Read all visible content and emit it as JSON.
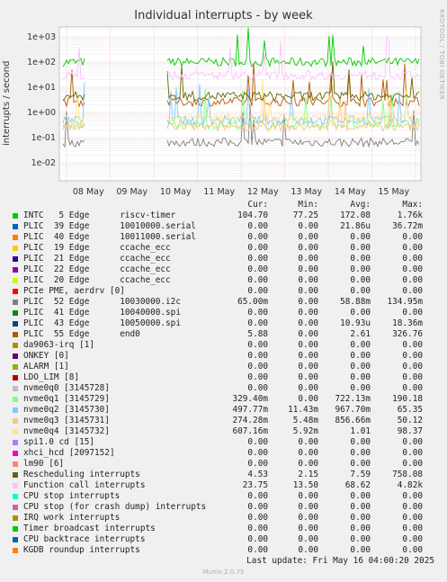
{
  "title": "Individual interrupts - by week",
  "side_label": "RRDTOOL / TOBI OETIKER",
  "footer": {
    "last_update": "Last update: Fri May 16 04:00:20 2025",
    "munin": "Munin 2.0.75"
  },
  "legend_headers": {
    "cur": "Cur:",
    "min": "Min:",
    "avg": "Avg:",
    "max": "Max:"
  },
  "chart_data": {
    "type": "line",
    "title": "Individual interrupts - by week",
    "ylabel": "interrupts / second",
    "yscale": "log",
    "ylim": [
      0.004,
      2000
    ],
    "y_ticks": [
      "1e+03",
      "1e+02",
      "1e+01",
      "1e+00",
      "1e-01",
      "1e-02"
    ],
    "x_ticks": [
      "08 May",
      "09 May",
      "10 May",
      "11 May",
      "12 May",
      "13 May",
      "14 May",
      "15 May"
    ],
    "no_data_period": "08 May 12:00 – 10 May 00:00",
    "series": [
      {
        "name": "INTC   5 Edge      riscv-timer",
        "color": "#00cc00",
        "cur": "104.70",
        "min": "77.25",
        "avg": "172.08",
        "max": "1.76k",
        "level": 100
      },
      {
        "name": "PLIC  39 Edge      10010000.serial",
        "color": "#0066b3",
        "cur": "0.00",
        "min": "0.00",
        "avg": "21.86u",
        "max": "36.72m"
      },
      {
        "name": "PLIC  40 Edge      10011000.serial",
        "color": "#ff8000",
        "cur": "0.00",
        "min": "0.00",
        "avg": "0.00",
        "max": "0.00"
      },
      {
        "name": "PLIC  19 Edge      ccache_ecc",
        "color": "#ffcc00",
        "cur": "0.00",
        "min": "0.00",
        "avg": "0.00",
        "max": "0.00"
      },
      {
        "name": "PLIC  21 Edge      ccache_ecc",
        "color": "#330099",
        "cur": "0.00",
        "min": "0.00",
        "avg": "0.00",
        "max": "0.00"
      },
      {
        "name": "PLIC  22 Edge      ccache_ecc",
        "color": "#990099",
        "cur": "0.00",
        "min": "0.00",
        "avg": "0.00",
        "max": "0.00"
      },
      {
        "name": "PLIC  20 Edge      ccache_ecc",
        "color": "#ccff00",
        "cur": "0.00",
        "min": "0.00",
        "avg": "0.00",
        "max": "0.00"
      },
      {
        "name": "PCIe PME, aerdrv [0]",
        "color": "#ff0000",
        "cur": "0.00",
        "min": "0.00",
        "avg": "0.00",
        "max": "0.00"
      },
      {
        "name": "PLIC  52 Edge      10030000.i2c",
        "color": "#808080",
        "cur": "65.00m",
        "min": "0.00",
        "avg": "58.88m",
        "max": "134.95m",
        "level": 0.065
      },
      {
        "name": "PLIC  41 Edge      10040000.spi",
        "color": "#008f00",
        "cur": "0.00",
        "min": "0.00",
        "avg": "0.00",
        "max": "0.00"
      },
      {
        "name": "PLIC  43 Edge      10050000.spi",
        "color": "#00487d",
        "cur": "0.00",
        "min": "0.00",
        "avg": "10.93u",
        "max": "18.36m"
      },
      {
        "name": "PLIC  55 Edge      end0",
        "color": "#b35a00",
        "cur": "5.88",
        "min": "0.00",
        "avg": "2.61",
        "max": "326.76",
        "level": 2.61
      },
      {
        "name": "da9063-irq [1]",
        "color": "#b38f00",
        "cur": "0.00",
        "min": "0.00",
        "avg": "0.00",
        "max": "0.00"
      },
      {
        "name": "ONKEY [0]",
        "color": "#6b006b",
        "cur": "0.00",
        "min": "0.00",
        "avg": "0.00",
        "max": "0.00"
      },
      {
        "name": "ALARM [1]",
        "color": "#8fb300",
        "cur": "0.00",
        "min": "0.00",
        "avg": "0.00",
        "max": "0.00"
      },
      {
        "name": "LDO_LIM [8]",
        "color": "#b30000",
        "cur": "0.00",
        "min": "0.00",
        "avg": "0.00",
        "max": "0.00"
      },
      {
        "name": "nvme0q0 [3145728]",
        "color": "#bebebe",
        "cur": "0.00",
        "min": "0.00",
        "avg": "0.00",
        "max": "0.00"
      },
      {
        "name": "nvme0q1 [3145729]",
        "color": "#80ff80",
        "cur": "329.40m",
        "min": "0.00",
        "avg": "722.13m",
        "max": "190.18",
        "level": 0.33
      },
      {
        "name": "nvme0q2 [3145730]",
        "color": "#80c9ff",
        "cur": "497.77m",
        "min": "11.43m",
        "avg": "967.70m",
        "max": "65.35",
        "level": 0.5
      },
      {
        "name": "nvme0q3 [3145731]",
        "color": "#ffc080",
        "cur": "274.28m",
        "min": "5.48m",
        "avg": "856.66m",
        "max": "50.12",
        "level": 0.27
      },
      {
        "name": "nvme0q4 [3145732]",
        "color": "#ffe680",
        "cur": "607.16m",
        "min": "5.92m",
        "avg": "1.01",
        "max": "98.37",
        "level": 0.61
      },
      {
        "name": "spi1.0 cd [15]",
        "color": "#aa80ff",
        "cur": "0.00",
        "min": "0.00",
        "avg": "0.00",
        "max": "0.00"
      },
      {
        "name": "xhci_hcd [2097152]",
        "color": "#ee00cc",
        "cur": "0.00",
        "min": "0.00",
        "avg": "0.00",
        "max": "0.00"
      },
      {
        "name": "lm90 [6]",
        "color": "#ff8080",
        "cur": "0.00",
        "min": "0.00",
        "avg": "0.00",
        "max": "0.00"
      },
      {
        "name": "Rescheduling interrupts",
        "color": "#666600",
        "cur": "4.53",
        "min": "2.15",
        "avg": "7.59",
        "max": "758.08",
        "level": 4.5
      },
      {
        "name": "Function call interrupts",
        "color": "#ffbfff",
        "cur": "23.75",
        "min": "13.50",
        "avg": "68.62",
        "max": "4.82k",
        "level": 30
      },
      {
        "name": "CPU stop interrupts",
        "color": "#00ffcc",
        "cur": "0.00",
        "min": "0.00",
        "avg": "0.00",
        "max": "0.00"
      },
      {
        "name": "CPU stop (for crash dump) interrupts",
        "color": "#cc6699",
        "cur": "0.00",
        "min": "0.00",
        "avg": "0.00",
        "max": "0.00"
      },
      {
        "name": "IRQ work interrupts",
        "color": "#999900",
        "cur": "0.00",
        "min": "0.00",
        "avg": "0.00",
        "max": "0.00"
      },
      {
        "name": "Timer broadcast interrupts",
        "color": "#00cc00",
        "cur": "0.00",
        "min": "0.00",
        "avg": "0.00",
        "max": "0.00"
      },
      {
        "name": "CPU backtrace interrupts",
        "color": "#0066b3",
        "cur": "0.00",
        "min": "0.00",
        "avg": "0.00",
        "max": "0.00"
      },
      {
        "name": "KGDB roundup interrupts",
        "color": "#ff8000",
        "cur": "0.00",
        "min": "0.00",
        "avg": "0.00",
        "max": "0.00"
      }
    ]
  }
}
